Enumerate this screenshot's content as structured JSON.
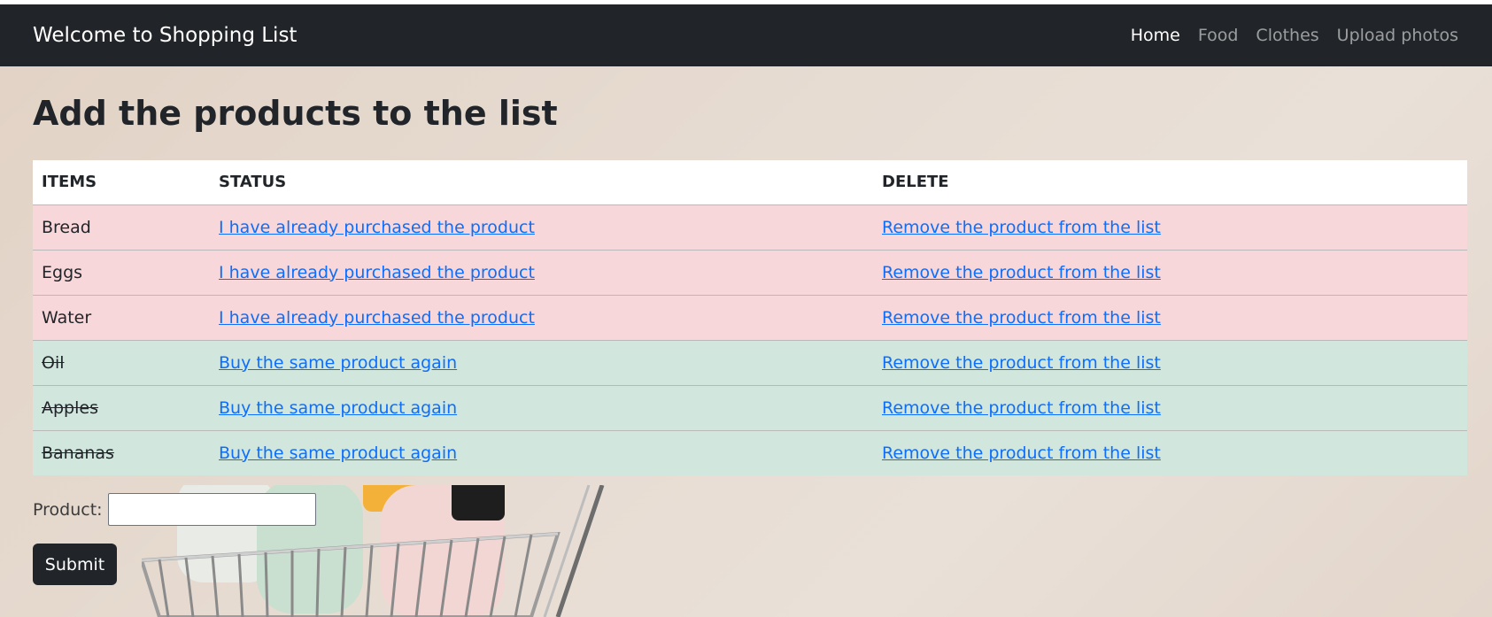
{
  "navbar": {
    "brand": "Welcome to Shopping List",
    "links": [
      {
        "label": "Home",
        "active": true
      },
      {
        "label": "Food",
        "active": false
      },
      {
        "label": "Clothes",
        "active": false
      },
      {
        "label": "Upload photos",
        "active": false
      }
    ]
  },
  "page": {
    "title": "Add the products to the list"
  },
  "table": {
    "headers": [
      "ITEMS",
      "STATUS",
      "DELETE"
    ],
    "rows": [
      {
        "item": "Bread",
        "status": "I have already purchased the product",
        "delete": "Remove the product from the list",
        "state": "pending"
      },
      {
        "item": "Eggs",
        "status": "I have already purchased the product",
        "delete": "Remove the product from the list",
        "state": "pending"
      },
      {
        "item": "Water",
        "status": "I have already purchased the product",
        "delete": "Remove the product from the list",
        "state": "pending"
      },
      {
        "item": "Oil",
        "status": "Buy the same product again",
        "delete": "Remove the product from the list",
        "state": "done"
      },
      {
        "item": "Apples",
        "status": "Buy the same product again",
        "delete": "Remove the product from the list",
        "state": "done"
      },
      {
        "item": "Bananas",
        "status": "Buy the same product again",
        "delete": "Remove the product from the list",
        "state": "done"
      }
    ]
  },
  "form": {
    "product_label": "Product:",
    "product_value": "",
    "submit_label": "Submit"
  },
  "colors": {
    "navbar_bg": "#212529",
    "pending_row": "#f8d7da",
    "done_row": "#d1e7dd",
    "link": "#0d6efd"
  },
  "background_image": "shopping-cart-photo"
}
